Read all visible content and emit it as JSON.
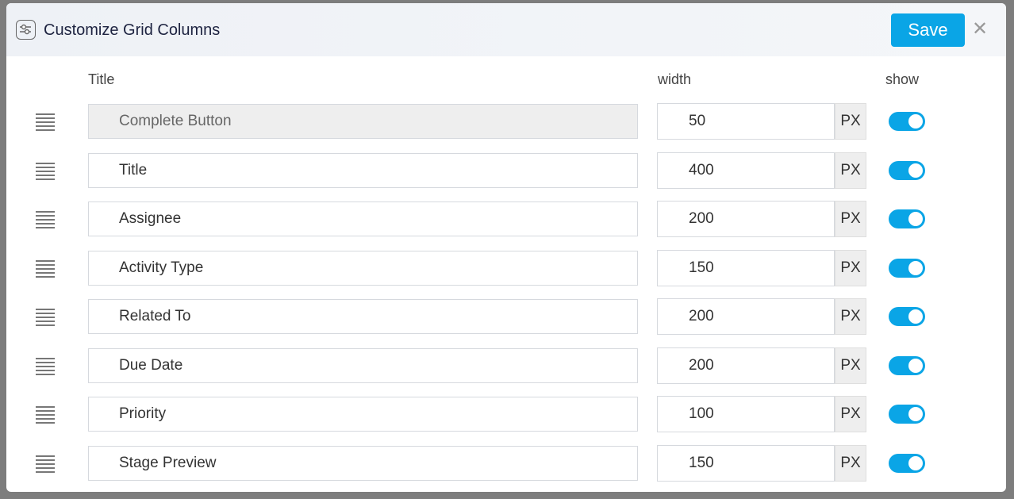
{
  "dialog": {
    "title": "Customize Grid Columns",
    "save_label": "Save",
    "close_icon": "close-icon",
    "header_icon": "sliders-icon"
  },
  "columns": {
    "title": "Title",
    "width": "width",
    "show": "show"
  },
  "unit": "PX",
  "accent": "#0aa5e6",
  "rows": [
    {
      "title": "Complete Button",
      "width": "50",
      "show": true,
      "disabled": true
    },
    {
      "title": "Title",
      "width": "400",
      "show": true
    },
    {
      "title": "Assignee",
      "width": "200",
      "show": true
    },
    {
      "title": "Activity Type",
      "width": "150",
      "show": true
    },
    {
      "title": "Related To",
      "width": "200",
      "show": true
    },
    {
      "title": "Due Date",
      "width": "200",
      "show": true
    },
    {
      "title": "Priority",
      "width": "100",
      "show": true
    },
    {
      "title": "Stage Preview",
      "width": "150",
      "show": true
    }
  ]
}
